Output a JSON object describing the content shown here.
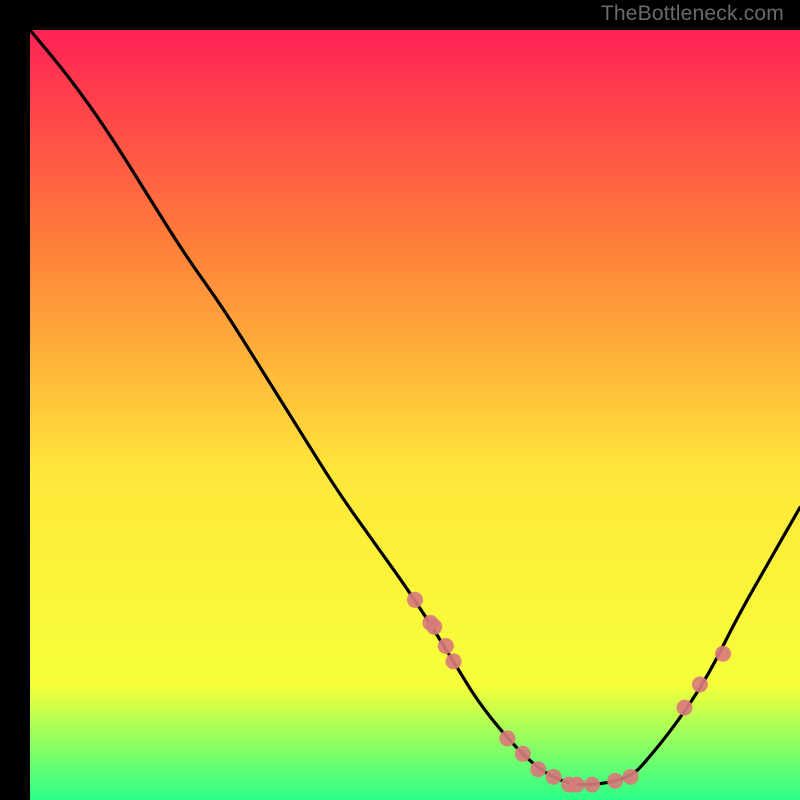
{
  "watermark": "TheBottleneck.com",
  "chart_data": {
    "type": "line",
    "title": "",
    "xlabel": "",
    "ylabel": "",
    "xlim": [
      0,
      100
    ],
    "ylim": [
      0,
      100
    ],
    "grid": false,
    "gradient": {
      "top": "#ff2255",
      "mid_upper": "#ff7f3a",
      "mid": "#ffe83a",
      "mid_lower": "#f6ff3a",
      "bottom": "#2aff88"
    },
    "curve": {
      "x": [
        0,
        5,
        10,
        15,
        20,
        25,
        30,
        35,
        40,
        45,
        50,
        55,
        58,
        62,
        66,
        70,
        74,
        78,
        80,
        84,
        88,
        92,
        96,
        100
      ],
      "y": [
        100,
        94,
        87,
        79,
        71,
        64,
        56,
        48,
        40,
        33,
        26,
        18,
        13,
        8,
        4,
        2,
        2,
        3,
        5,
        10,
        16,
        24,
        31,
        38
      ]
    },
    "markers": {
      "x": [
        50,
        52,
        52.5,
        54,
        55,
        62,
        64,
        66,
        68,
        70,
        71,
        73,
        76,
        78,
        85,
        87,
        90
      ],
      "y": [
        26,
        23,
        22.5,
        20,
        18,
        8,
        6,
        4,
        3,
        2,
        2,
        2,
        2.5,
        3,
        12,
        15,
        19
      ],
      "color": "#d77b7b",
      "radius": 8
    }
  }
}
